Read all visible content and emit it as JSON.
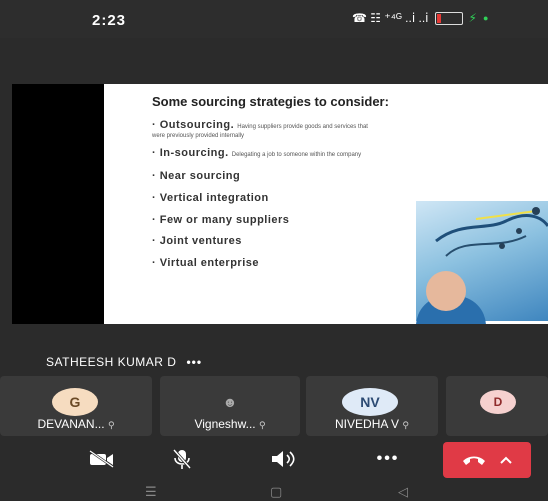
{
  "status_bar": {
    "time": "2:23",
    "indicators_text": "☎  ☷ ⁺⁴ᴳ ..ⅰ ..ⅰ",
    "battery_level": 0.15
  },
  "slide": {
    "title": "Some sourcing strategies to consider:",
    "bullets": [
      {
        "main": "· Outsourcing.",
        "desc": "Having suppliers provide goods and services that",
        "desc2": "were previously provided internally"
      },
      {
        "main": "· In-sourcing.",
        "desc": "Delegating a job to someone within the company",
        "desc2": ""
      },
      {
        "main": "· Near sourcing",
        "desc": "",
        "desc2": ""
      },
      {
        "main": "· Vertical integration",
        "desc": "",
        "desc2": ""
      },
      {
        "main": "· Few or many suppliers",
        "desc": "",
        "desc2": ""
      },
      {
        "main": "· Joint ventures",
        "desc": "",
        "desc2": ""
      },
      {
        "main": "· Virtual enterprise",
        "desc": "",
        "desc2": ""
      }
    ]
  },
  "presenter": {
    "name": "SATHEESH KUMAR D",
    "more_label": "•••"
  },
  "participants": [
    {
      "initials": "G",
      "name": "DEVANAN...",
      "avatar_color": "#f6dcc0",
      "text_color": "#6b4a26"
    },
    {
      "initials": "",
      "name": "Vigneshw...",
      "avatar_color": "#3a3a3a",
      "text_color": "#cccccc"
    },
    {
      "initials": "NV",
      "name": "NIVEDHA V",
      "avatar_color": "#dfeaf7",
      "text_color": "#2c4a73"
    },
    {
      "initials": "D",
      "name": "",
      "avatar_color": "#f6d1cf",
      "text_color": "#8f2b2b"
    }
  ],
  "controls": {
    "more_label": "•••",
    "end_call_color": "#e03a46"
  }
}
